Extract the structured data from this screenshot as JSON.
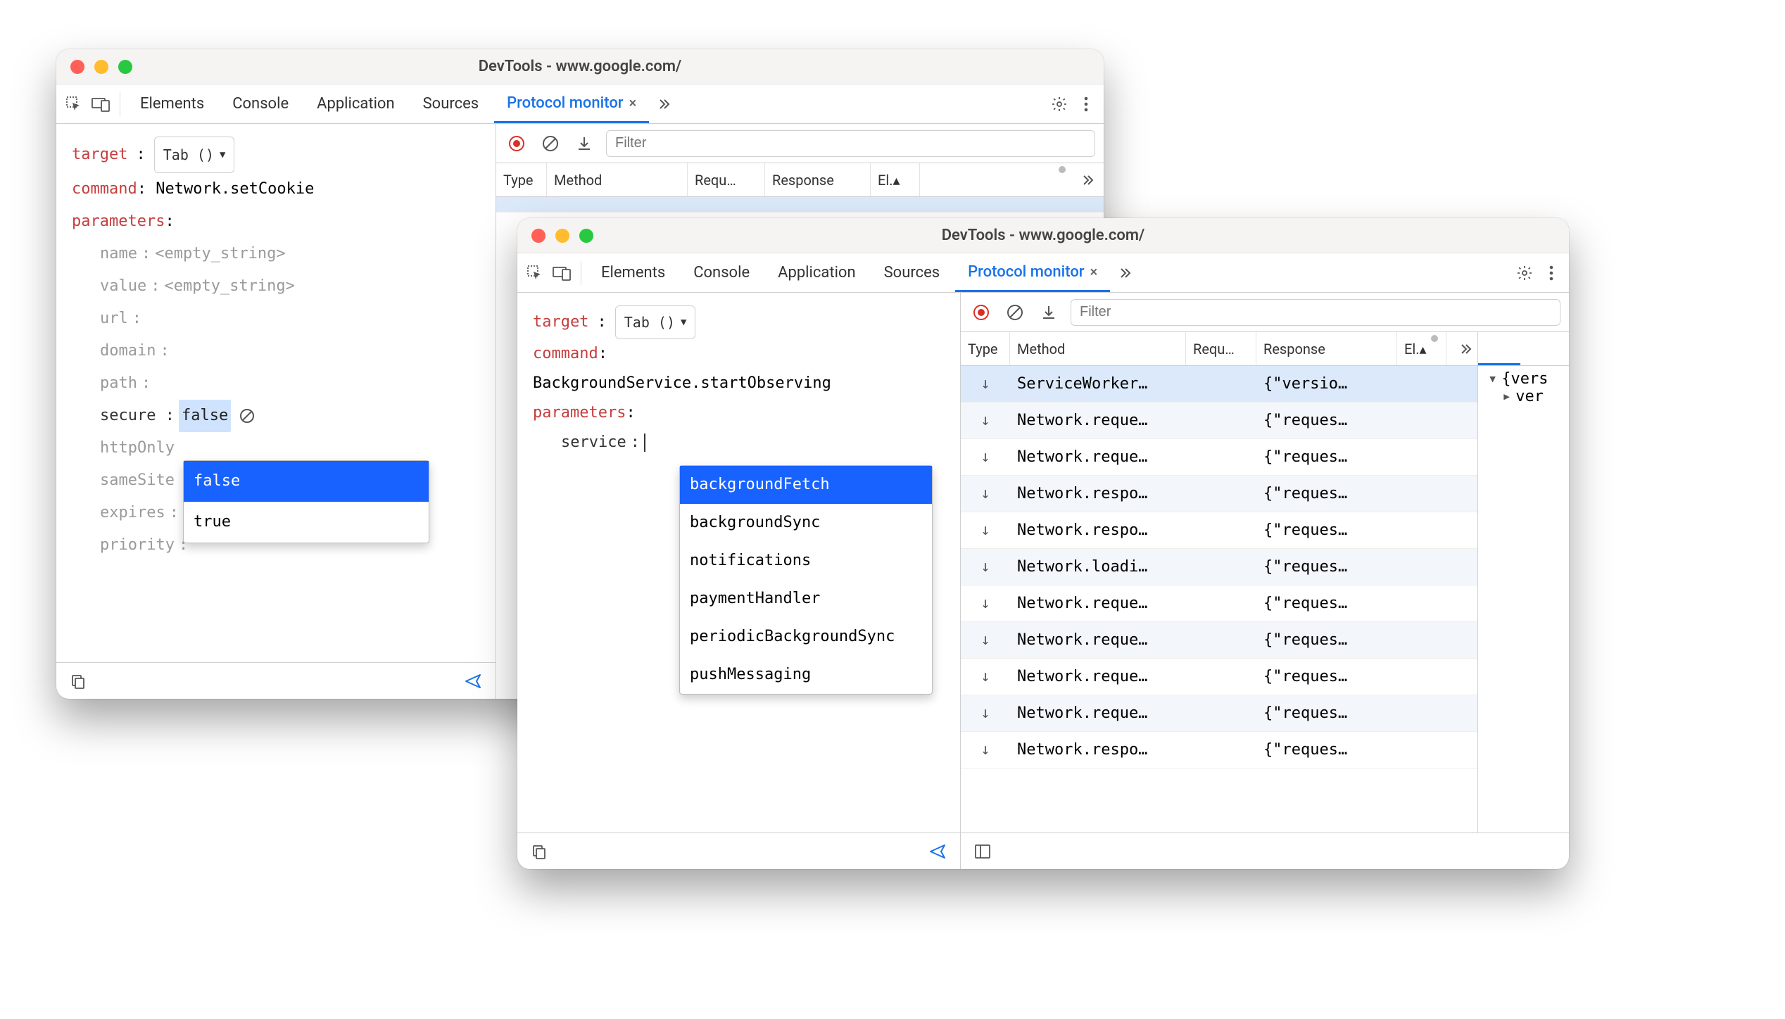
{
  "windows": {
    "w1": {
      "title": "DevTools - www.google.com/",
      "tabs": [
        "Elements",
        "Console",
        "Application",
        "Sources",
        "Protocol monitor"
      ],
      "active_tab": "Protocol monitor",
      "left": {
        "target_label": "target",
        "target_value": "Tab ()",
        "command_label": "command",
        "command_value": "Network.setCookie",
        "parameters_label": "parameters",
        "params": [
          {
            "name": "name",
            "value": "<empty_string>",
            "faded_value": true
          },
          {
            "name": "value",
            "value": "<empty_string>",
            "faded_value": true
          },
          {
            "name": "url",
            "value": ""
          },
          {
            "name": "domain",
            "value": ""
          },
          {
            "name": "path",
            "value": ""
          },
          {
            "name": "secure",
            "value": "false",
            "editing": true
          },
          {
            "name": "httpOnly",
            "value": ""
          },
          {
            "name": "sameSite",
            "value": ""
          },
          {
            "name": "expires",
            "value": ""
          },
          {
            "name": "priority",
            "value": ""
          }
        ],
        "dropdown_options": [
          "false",
          "true"
        ],
        "dropdown_selected": "false"
      },
      "right": {
        "filter_placeholder": "Filter",
        "columns": {
          "type": "Type",
          "method": "Method",
          "request": "Requ…",
          "response": "Response",
          "elapsed": "El.▴"
        }
      }
    },
    "w2": {
      "title": "DevTools - www.google.com/",
      "tabs": [
        "Elements",
        "Console",
        "Application",
        "Sources",
        "Protocol monitor"
      ],
      "active_tab": "Protocol monitor",
      "left": {
        "target_label": "target",
        "target_value": "Tab ()",
        "command_label": "command",
        "command_value": "BackgroundService.startObserving",
        "parameters_label": "parameters",
        "params": [
          {
            "name": "service",
            "value": "",
            "editing": true
          }
        ],
        "dropdown_options": [
          "backgroundFetch",
          "backgroundSync",
          "notifications",
          "paymentHandler",
          "periodicBackgroundSync",
          "pushMessaging"
        ],
        "dropdown_selected": "backgroundFetch"
      },
      "right": {
        "filter_placeholder": "Filter",
        "columns": {
          "type": "Type",
          "method": "Method",
          "request": "Requ…",
          "response": "Response",
          "elapsed": "El.▴"
        },
        "rows": [
          {
            "method": "ServiceWorker…",
            "response": "{\"versio…",
            "selected": true
          },
          {
            "method": "Network.reque…",
            "response": "{\"reques…"
          },
          {
            "method": "Network.reque…",
            "response": "{\"reques…"
          },
          {
            "method": "Network.respo…",
            "response": "{\"reques…"
          },
          {
            "method": "Network.respo…",
            "response": "{\"reques…"
          },
          {
            "method": "Network.loadi…",
            "response": "{\"reques…"
          },
          {
            "method": "Network.reque…",
            "response": "{\"reques…"
          },
          {
            "method": "Network.reque…",
            "response": "{\"reques…"
          },
          {
            "method": "Network.reque…",
            "response": "{\"reques…"
          },
          {
            "method": "Network.reque…",
            "response": "{\"reques…"
          },
          {
            "method": "Network.respo…",
            "response": "{\"reques…"
          }
        ],
        "detail": {
          "root": "{vers",
          "child": "ver"
        }
      }
    }
  }
}
